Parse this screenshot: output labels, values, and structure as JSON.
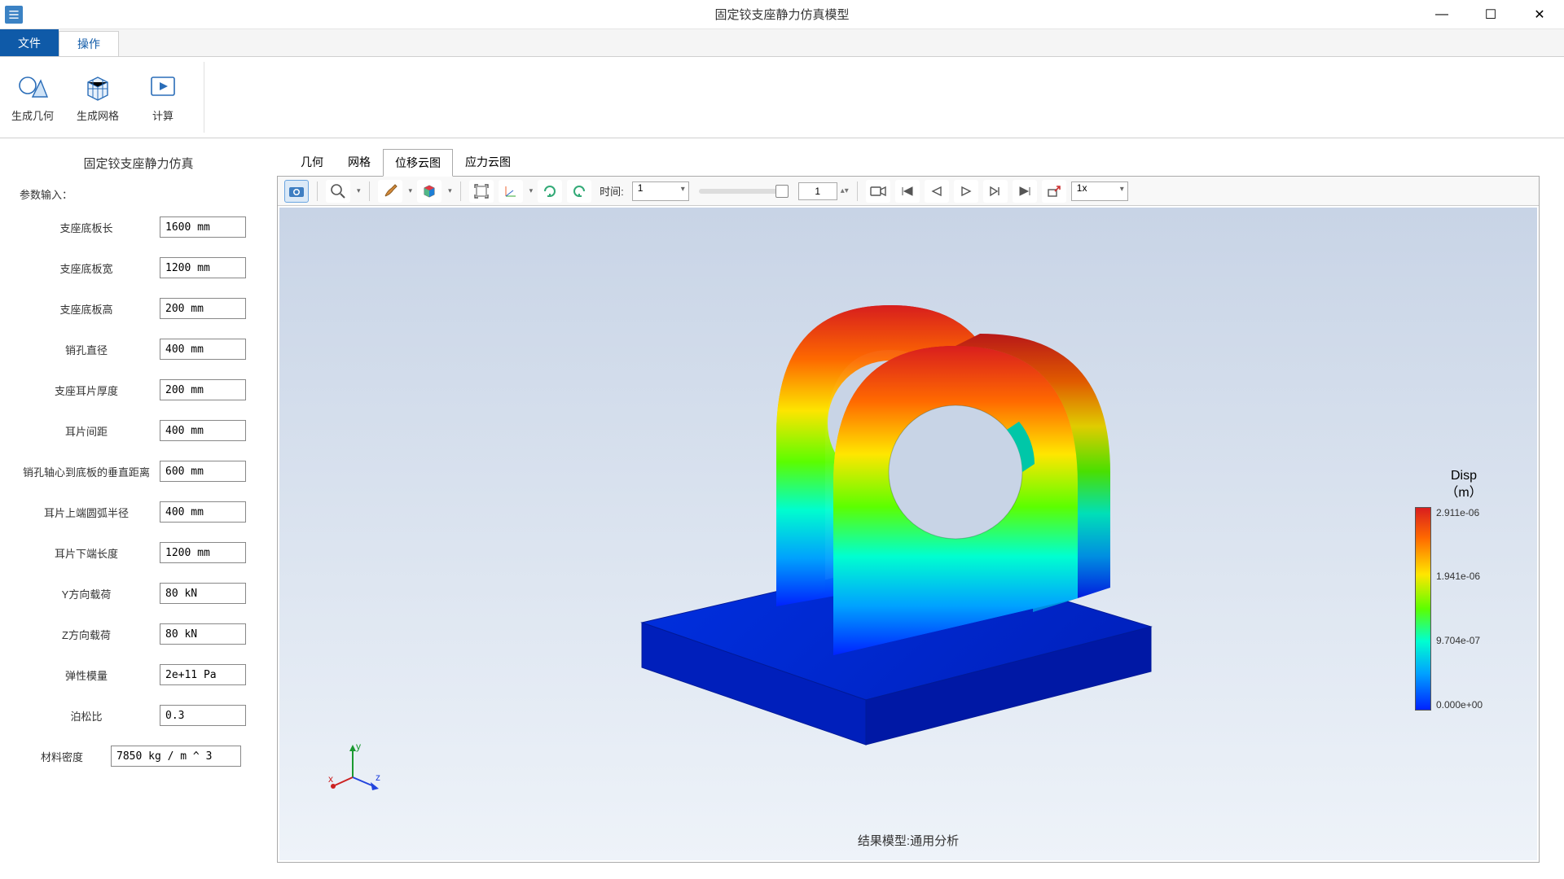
{
  "window": {
    "title": "固定铰支座静力仿真模型",
    "controls": {
      "min": "—",
      "max": "☐",
      "close": "✕"
    }
  },
  "menubar": {
    "file": "文件",
    "operate": "操作"
  },
  "ribbon": {
    "gen_geom": "生成几何",
    "gen_mesh": "生成网格",
    "compute": "计算"
  },
  "panel": {
    "title": "固定铰支座静力仿真",
    "header": "参数输入：",
    "params": [
      {
        "label": "支座底板长",
        "value": "1600 mm"
      },
      {
        "label": "支座底板宽",
        "value": "1200 mm"
      },
      {
        "label": "支座底板高",
        "value": "200 mm"
      },
      {
        "label": "销孔直径",
        "value": "400 mm"
      },
      {
        "label": "支座耳片厚度",
        "value": "200 mm"
      },
      {
        "label": "耳片间距",
        "value": "400 mm"
      },
      {
        "label": "销孔轴心到底板的垂直距离",
        "value": "600 mm"
      },
      {
        "label": "耳片上端圆弧半径",
        "value": "400 mm"
      },
      {
        "label": "耳片下端长度",
        "value": "1200 mm"
      },
      {
        "label": "Y方向载荷",
        "value": "80 kN"
      },
      {
        "label": "Z方向载荷",
        "value": "80 kN"
      },
      {
        "label": "弹性模量",
        "value": "2e+11 Pa"
      },
      {
        "label": "泊松比",
        "value": "0.3"
      },
      {
        "label": "材料密度",
        "value": "7850 kg / m ^ 3"
      }
    ]
  },
  "viewtabs": {
    "geom": "几何",
    "mesh": "网格",
    "disp": "位移云图",
    "stress": "应力云图",
    "active": "disp"
  },
  "toolbar": {
    "time_label": "时间:",
    "time_combo": "1",
    "frame_input": "1",
    "speed_combo": "1x"
  },
  "canvas": {
    "footer": "结果模型:通用分析",
    "axes": {
      "x": "x",
      "y": "y",
      "z": "z"
    }
  },
  "legend": {
    "title_l1": "Disp",
    "title_l2": "（m）",
    "ticks": [
      "2.911e-06",
      "1.941e-06",
      "9.704e-07",
      "0.000e+00"
    ]
  },
  "chart_data": {
    "type": "heatmap",
    "title": "Disp (m) — displacement contour on fixed hinge seat",
    "colormap": "rainbow",
    "range": [
      0.0,
      2.911e-06
    ],
    "ticks": [
      0.0,
      9.704e-07,
      1.941e-06,
      2.911e-06
    ],
    "result_label": "结果模型:通用分析",
    "description": "Base plate near 0 displacement (blue); top of hinge ears near max 2.911e-06 m (red)."
  }
}
